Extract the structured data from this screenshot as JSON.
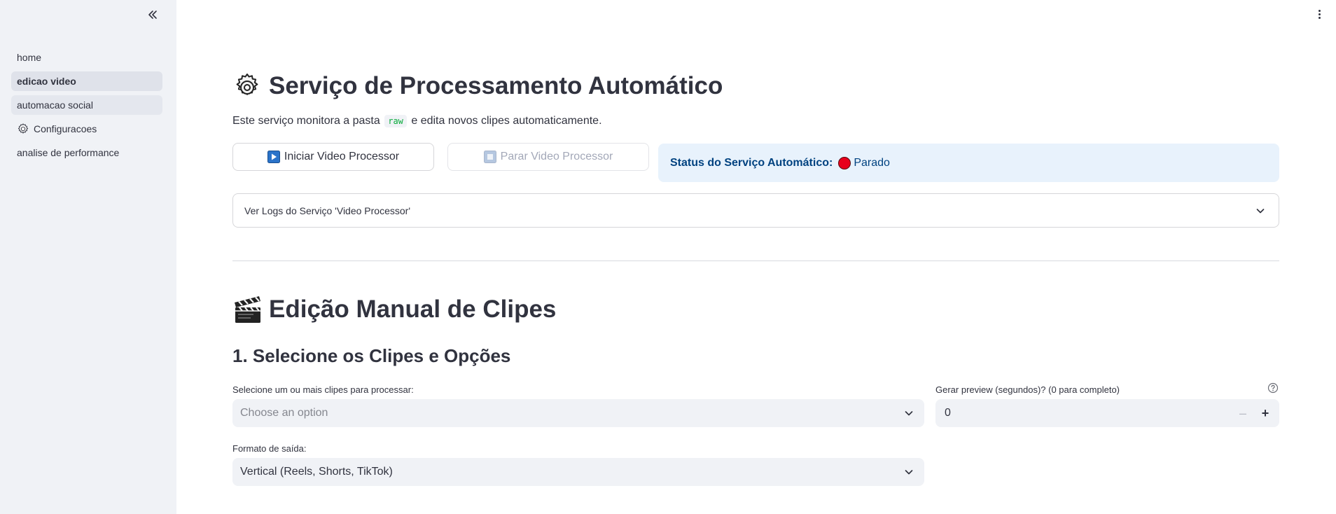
{
  "sidebar": {
    "items": [
      {
        "label": "home"
      },
      {
        "label": "edicao video"
      },
      {
        "label": "automacao social"
      },
      {
        "label": "Configuracoes"
      },
      {
        "label": "analise de performance"
      }
    ]
  },
  "auto_service": {
    "title": "Serviço de Processamento Automático",
    "desc_before": "Este serviço monitora a pasta",
    "desc_code": "raw",
    "desc_after": "e edita novos clipes automaticamente.",
    "start_button": "Iniciar Video Processor",
    "stop_button": "Parar Video Processor",
    "status_label": "Status do Serviço Automático:",
    "status_value": "Parado",
    "logs_expander": "Ver Logs do Serviço 'Video Processor'"
  },
  "manual": {
    "title": "Edição Manual de Clipes",
    "subtitle": "1. Selecione os Clipes e Opções",
    "clips_label": "Selecione um ou mais clipes para processar:",
    "clips_placeholder": "Choose an option",
    "preview_label": "Gerar preview (segundos)? (0 para completo)",
    "preview_value": "0",
    "format_label": "Formato de saída:",
    "format_value": "Vertical (Reels, Shorts, TikTok)"
  },
  "colors": {
    "sidebar_bg": "#f0f2f6",
    "status_bg": "#e8f2fc",
    "status_text": "#004280",
    "status_dot": "#e8001c",
    "code_text": "#09ab3b"
  }
}
